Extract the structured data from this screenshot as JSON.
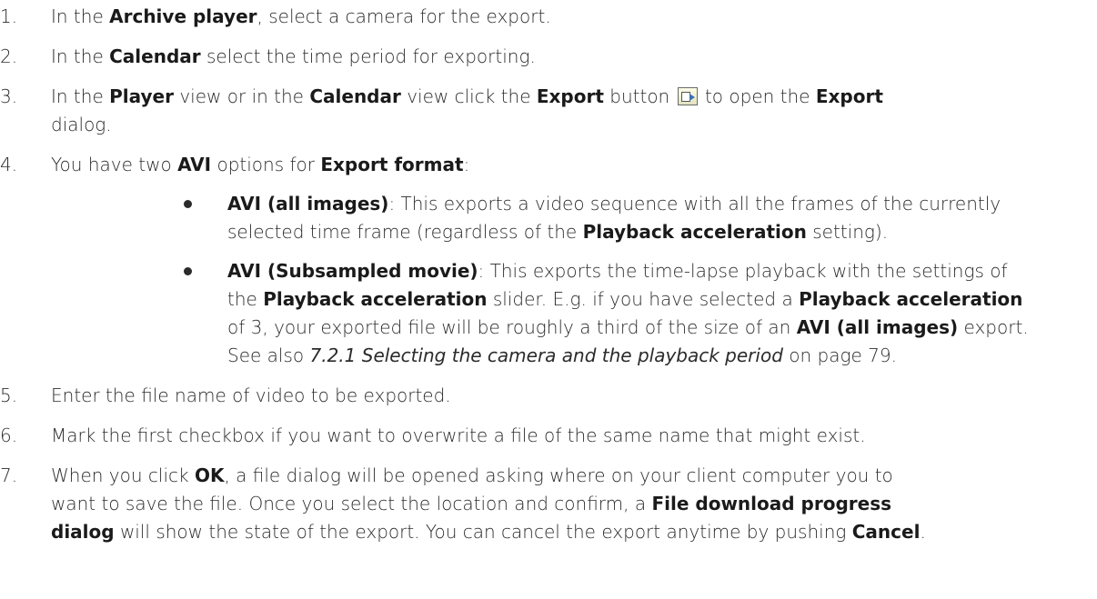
{
  "steps": [
    {
      "num": "1.",
      "a": "In the ",
      "b1": "Archive player",
      "c": ", select a camera for the export."
    },
    {
      "num": "2.",
      "a": "In the ",
      "b1": "Calendar",
      "c": " select the time period for exporting."
    },
    {
      "num": "3.",
      "a": "In the ",
      "b1": "Player",
      "c": " view or in the ",
      "b2": "Calendar",
      "d": " view click the ",
      "b3": "Export",
      "e": " button",
      "f": " to open the ",
      "b4": "Export",
      "g": "dialog."
    },
    {
      "num": "4.",
      "a": "You have two ",
      "b1": "AVI",
      "c": " options for ",
      "b2": "Export format",
      "d": ":"
    },
    {
      "num": "5.",
      "a": "Enter the file name of video to be exported."
    },
    {
      "num": "6.",
      "a": "Mark the first checkbox if you want to overwrite a file of the same name that might exist."
    },
    {
      "num": "7.",
      "a": "When you click ",
      "b1": "OK",
      "c": ", a file dialog will be opened asking where on your client computer you to",
      "d": "want to save the file. Once you select the location and confirm, a ",
      "b2": "File download progress",
      "b3": "dialog",
      "e": " will show the state of the export. You can cancel the export anytime by pushing ",
      "b4": "Cancel",
      "f": "."
    }
  ],
  "bullets": [
    {
      "b1": "AVI (all images)",
      "a": ": This exports a video sequence with all the frames of the currently",
      "b": "selected time frame (regardless of the ",
      "b2": "Playback acceleration",
      "c": " setting)."
    },
    {
      "b1": "AVI (Subsampled movie)",
      "a": ": This exports the time-lapse playback with the settings of",
      "b": "the ",
      "b2": "Playback acceleration",
      "c": " slider. E.g. if you have selected a ",
      "b3": "Playback acceleration",
      "d": "of 3, your exported file will be roughly a third of the size of an ",
      "b4": "AVI (all images)",
      "e": " export.",
      "f": "See also ",
      "link": "7.2.1 Selecting the camera and the playback period",
      "g": " on page 79."
    }
  ],
  "icons": {
    "export": "export-icon"
  }
}
